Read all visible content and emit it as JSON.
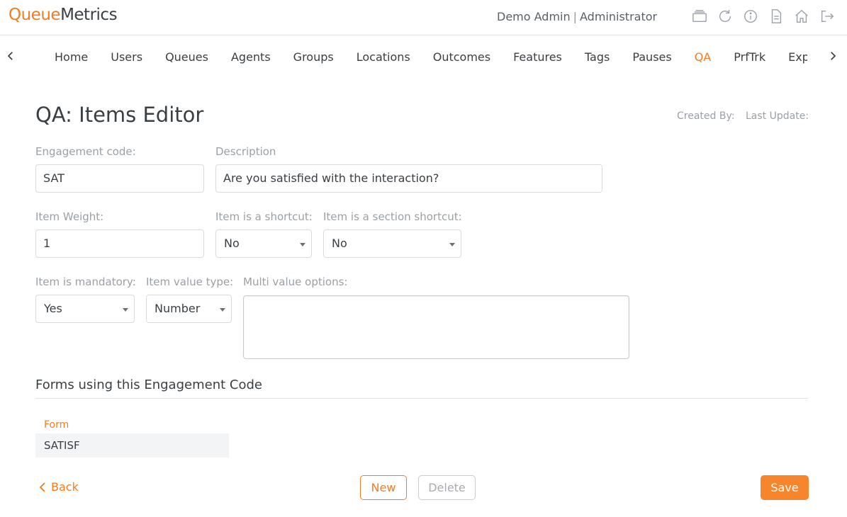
{
  "header": {
    "logo_queue": "Queue",
    "logo_metrics": "Metrics",
    "user_name": "Demo Admin",
    "separator": "|",
    "user_role": "Administrator",
    "icons": [
      "window-icon",
      "refresh-icon",
      "info-icon",
      "document-icon",
      "home-icon",
      "logout-icon"
    ]
  },
  "nav": {
    "items": [
      {
        "label": "Home"
      },
      {
        "label": "Users"
      },
      {
        "label": "Queues"
      },
      {
        "label": "Agents"
      },
      {
        "label": "Groups"
      },
      {
        "label": "Locations"
      },
      {
        "label": "Outcomes"
      },
      {
        "label": "Features"
      },
      {
        "label": "Tags"
      },
      {
        "label": "Pauses"
      },
      {
        "label": "QA"
      },
      {
        "label": "PrfTrk"
      },
      {
        "label": "Export"
      }
    ],
    "active": "QA"
  },
  "page": {
    "title": "QA: Items Editor",
    "created_by_label": "Created By:",
    "last_update_label": "Last Update:"
  },
  "form": {
    "engagement_code_label": "Engagement code:",
    "engagement_code_value": "SAT",
    "description_label": "Description",
    "description_value": "Are you satisfied with the interaction?",
    "item_weight_label": "Item Weight:",
    "item_weight_value": "1",
    "shortcut_label": "Item is a shortcut:",
    "shortcut_value": "No",
    "section_shortcut_label": "Item is a section shortcut:",
    "section_shortcut_value": "No",
    "mandatory_label": "Item is mandatory:",
    "mandatory_value": "Yes",
    "value_type_label": "Item value type:",
    "value_type_value": "Number",
    "multi_value_label": "Multi value options:",
    "multi_value_value": ""
  },
  "forms_section": {
    "title": "Forms using this Engagement Code",
    "column_header": "Form",
    "rows": [
      {
        "form": "SATISF"
      }
    ]
  },
  "footer": {
    "back_label": "Back",
    "new_label": "New",
    "delete_label": "Delete",
    "save_label": "Save"
  },
  "colors": {
    "accent": "#f47c20",
    "text": "#3a3f44",
    "muted": "#9aa0a6",
    "border": "#d9dadc"
  }
}
